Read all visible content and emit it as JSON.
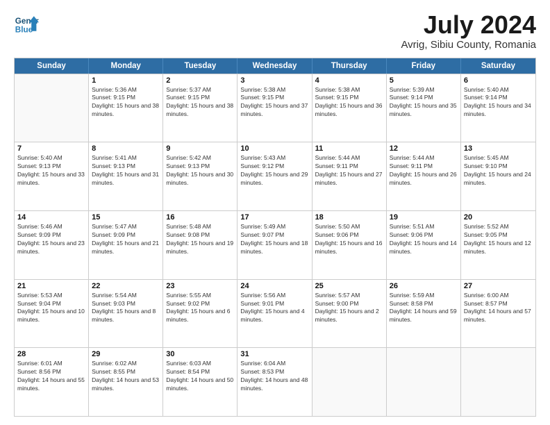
{
  "header": {
    "logo_line1": "General",
    "logo_line2": "Blue",
    "month_year": "July 2024",
    "location": "Avrig, Sibiu County, Romania"
  },
  "days_of_week": [
    "Sunday",
    "Monday",
    "Tuesday",
    "Wednesday",
    "Thursday",
    "Friday",
    "Saturday"
  ],
  "weeks": [
    [
      {
        "day": "",
        "empty": true
      },
      {
        "day": "1",
        "sunrise": "5:36 AM",
        "sunset": "9:15 PM",
        "daylight": "15 hours and 38 minutes."
      },
      {
        "day": "2",
        "sunrise": "5:37 AM",
        "sunset": "9:15 PM",
        "daylight": "15 hours and 38 minutes."
      },
      {
        "day": "3",
        "sunrise": "5:38 AM",
        "sunset": "9:15 PM",
        "daylight": "15 hours and 37 minutes."
      },
      {
        "day": "4",
        "sunrise": "5:38 AM",
        "sunset": "9:15 PM",
        "daylight": "15 hours and 36 minutes."
      },
      {
        "day": "5",
        "sunrise": "5:39 AM",
        "sunset": "9:14 PM",
        "daylight": "15 hours and 35 minutes."
      },
      {
        "day": "6",
        "sunrise": "5:40 AM",
        "sunset": "9:14 PM",
        "daylight": "15 hours and 34 minutes."
      }
    ],
    [
      {
        "day": "7",
        "sunrise": "5:40 AM",
        "sunset": "9:13 PM",
        "daylight": "15 hours and 33 minutes."
      },
      {
        "day": "8",
        "sunrise": "5:41 AM",
        "sunset": "9:13 PM",
        "daylight": "15 hours and 31 minutes."
      },
      {
        "day": "9",
        "sunrise": "5:42 AM",
        "sunset": "9:13 PM",
        "daylight": "15 hours and 30 minutes."
      },
      {
        "day": "10",
        "sunrise": "5:43 AM",
        "sunset": "9:12 PM",
        "daylight": "15 hours and 29 minutes."
      },
      {
        "day": "11",
        "sunrise": "5:44 AM",
        "sunset": "9:11 PM",
        "daylight": "15 hours and 27 minutes."
      },
      {
        "day": "12",
        "sunrise": "5:44 AM",
        "sunset": "9:11 PM",
        "daylight": "15 hours and 26 minutes."
      },
      {
        "day": "13",
        "sunrise": "5:45 AM",
        "sunset": "9:10 PM",
        "daylight": "15 hours and 24 minutes."
      }
    ],
    [
      {
        "day": "14",
        "sunrise": "5:46 AM",
        "sunset": "9:09 PM",
        "daylight": "15 hours and 23 minutes."
      },
      {
        "day": "15",
        "sunrise": "5:47 AM",
        "sunset": "9:09 PM",
        "daylight": "15 hours and 21 minutes."
      },
      {
        "day": "16",
        "sunrise": "5:48 AM",
        "sunset": "9:08 PM",
        "daylight": "15 hours and 19 minutes."
      },
      {
        "day": "17",
        "sunrise": "5:49 AM",
        "sunset": "9:07 PM",
        "daylight": "15 hours and 18 minutes."
      },
      {
        "day": "18",
        "sunrise": "5:50 AM",
        "sunset": "9:06 PM",
        "daylight": "15 hours and 16 minutes."
      },
      {
        "day": "19",
        "sunrise": "5:51 AM",
        "sunset": "9:06 PM",
        "daylight": "15 hours and 14 minutes."
      },
      {
        "day": "20",
        "sunrise": "5:52 AM",
        "sunset": "9:05 PM",
        "daylight": "15 hours and 12 minutes."
      }
    ],
    [
      {
        "day": "21",
        "sunrise": "5:53 AM",
        "sunset": "9:04 PM",
        "daylight": "15 hours and 10 minutes."
      },
      {
        "day": "22",
        "sunrise": "5:54 AM",
        "sunset": "9:03 PM",
        "daylight": "15 hours and 8 minutes."
      },
      {
        "day": "23",
        "sunrise": "5:55 AM",
        "sunset": "9:02 PM",
        "daylight": "15 hours and 6 minutes."
      },
      {
        "day": "24",
        "sunrise": "5:56 AM",
        "sunset": "9:01 PM",
        "daylight": "15 hours and 4 minutes."
      },
      {
        "day": "25",
        "sunrise": "5:57 AM",
        "sunset": "9:00 PM",
        "daylight": "15 hours and 2 minutes."
      },
      {
        "day": "26",
        "sunrise": "5:59 AM",
        "sunset": "8:58 PM",
        "daylight": "14 hours and 59 minutes."
      },
      {
        "day": "27",
        "sunrise": "6:00 AM",
        "sunset": "8:57 PM",
        "daylight": "14 hours and 57 minutes."
      }
    ],
    [
      {
        "day": "28",
        "sunrise": "6:01 AM",
        "sunset": "8:56 PM",
        "daylight": "14 hours and 55 minutes."
      },
      {
        "day": "29",
        "sunrise": "6:02 AM",
        "sunset": "8:55 PM",
        "daylight": "14 hours and 53 minutes."
      },
      {
        "day": "30",
        "sunrise": "6:03 AM",
        "sunset": "8:54 PM",
        "daylight": "14 hours and 50 minutes."
      },
      {
        "day": "31",
        "sunrise": "6:04 AM",
        "sunset": "8:53 PM",
        "daylight": "14 hours and 48 minutes."
      },
      {
        "day": "",
        "empty": true
      },
      {
        "day": "",
        "empty": true
      },
      {
        "day": "",
        "empty": true
      }
    ]
  ]
}
